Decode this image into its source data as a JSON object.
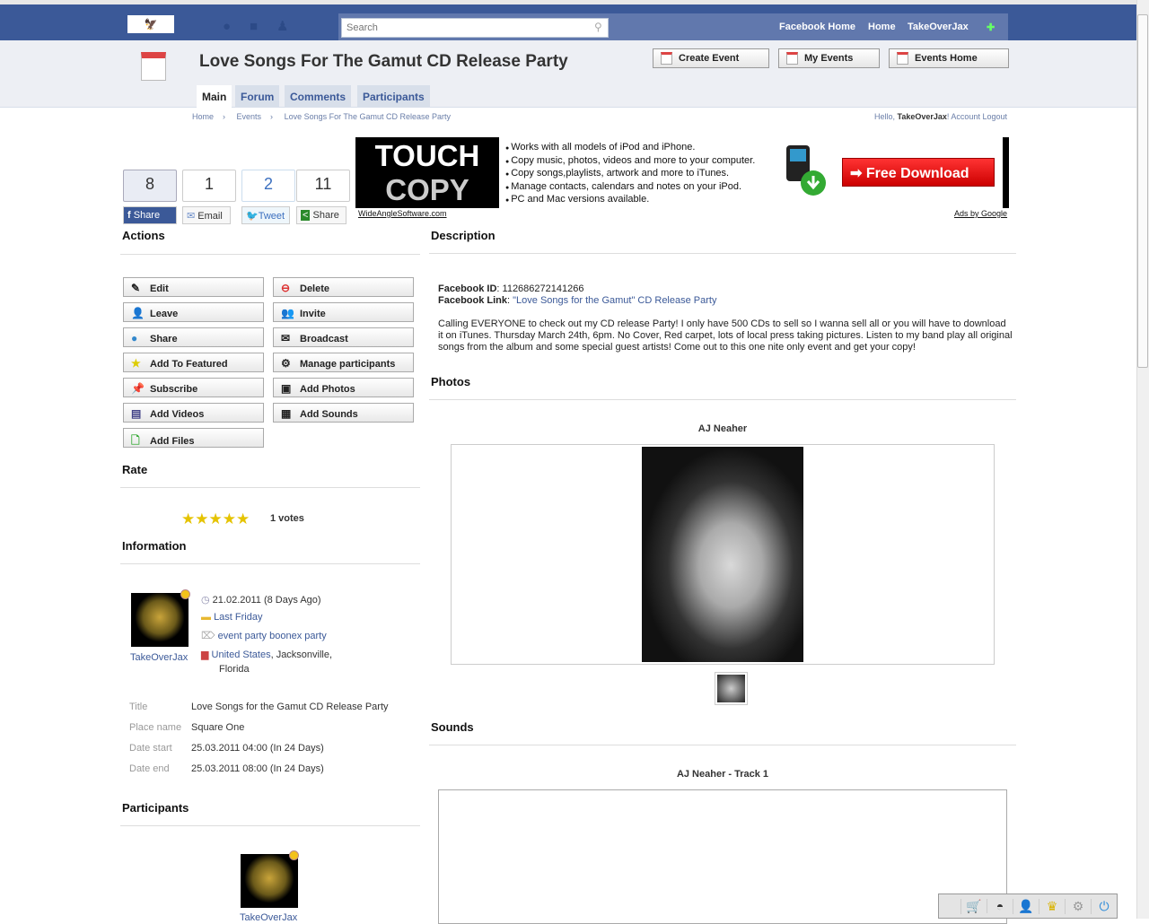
{
  "topbar": {
    "search_placeholder": "Search",
    "links": [
      "Facebook Home",
      "Home",
      "TakeOverJax"
    ]
  },
  "header": {
    "title": "Love Songs For The Gamut CD Release Party",
    "buttons": [
      "Create Event",
      "My Events",
      "Events Home"
    ]
  },
  "tabs": [
    "Main",
    "Forum",
    "Comments",
    "Participants"
  ],
  "breadcrumb": [
    "Home",
    "Events",
    "Love Songs For The Gamut CD Release Party"
  ],
  "account": {
    "hello": "Hello,",
    "user": "TakeOverJax",
    "suffix": "!",
    "account": "Account",
    "logout": "Logout"
  },
  "share": [
    {
      "count": "8",
      "label": "Share"
    },
    {
      "count": "1",
      "label": "Email"
    },
    {
      "count": "2",
      "label": "Tweet"
    },
    {
      "count": "11",
      "label": "Share"
    }
  ],
  "ad": {
    "brand1": "TOUCH",
    "brand2": "COPY",
    "bullets": [
      "Works with all models of iPod and iPhone.",
      "Copy music, photos, videos and more to your computer.",
      "Copy songs,playlists, artwork and more to iTunes.",
      "Manage contacts, calendars and notes on your iPod.",
      "PC and Mac versions available."
    ],
    "cta": "Free Download",
    "site": "WideAngleSoftware.com",
    "ads_by": "Ads by Google"
  },
  "actions": {
    "title": "Actions",
    "items": [
      "Edit",
      "Delete",
      "Leave",
      "Invite",
      "Share",
      "Broadcast",
      "Add To Featured",
      "Manage participants",
      "Subscribe",
      "Add Photos",
      "Add Videos",
      "Add Sounds",
      "Add Files"
    ]
  },
  "rate": {
    "title": "Rate",
    "votes": "1 votes",
    "rating": 5
  },
  "information": {
    "title": "Information",
    "author": "TakeOverJax",
    "date": "21.02.2011 (8 Days Ago)",
    "category": "Last Friday",
    "tags": "event party boonex party",
    "country": "United States",
    "city": ", Jacksonville,",
    "state": "Florida",
    "fields": [
      {
        "label": "Title",
        "value": "Love Songs for the Gamut CD Release Party"
      },
      {
        "label": "Place name",
        "value": "Square One"
      },
      {
        "label": "Date start",
        "value": "25.03.2011 04:00 (In 24 Days)"
      },
      {
        "label": "Date end",
        "value": "25.03.2011 08:00 (In 24 Days)"
      }
    ]
  },
  "participants": {
    "title": "Participants",
    "name": "TakeOverJax"
  },
  "description": {
    "title": "Description",
    "fb_id_label": "Facebook ID",
    "fb_id": ": 112686272141266",
    "fb_link_label": "Facebook Link",
    "fb_link_sep": ": ",
    "fb_link": "\"Love Songs for the Gamut\" CD Release Party",
    "body": "Calling EVERYONE to check out my CD release Party! I only have 500 CDs to sell so I wanna sell all or you will have to download it on iTunes. Thursday March 24th, 6pm. No Cover, Red carpet, lots of local press taking pictures. Listen to my band play all original songs from the album and some special guest artists! Come out to this one nite only event and get your copy!"
  },
  "photos": {
    "title": "Photos",
    "caption": "AJ Neaher"
  },
  "sounds": {
    "title": "Sounds",
    "caption": "AJ Neaher - Track 1"
  }
}
